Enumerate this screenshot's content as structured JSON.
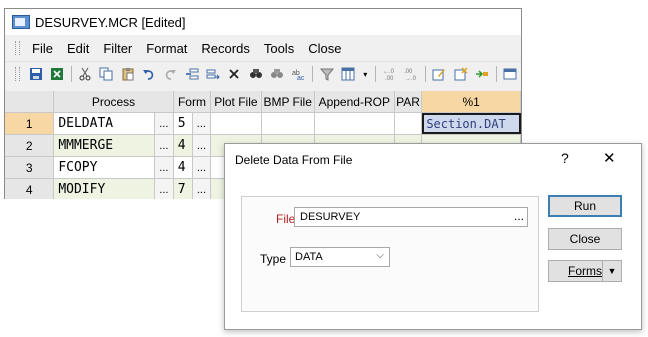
{
  "window": {
    "title": "DESURVEY.MCR [Edited]"
  },
  "menu": [
    "File",
    "Edit",
    "Filter",
    "Format",
    "Records",
    "Tools",
    "Close"
  ],
  "toolbar_icons": [
    "save-icon",
    "excel-export-icon",
    "cut-icon",
    "copy-icon",
    "paste-icon",
    "undo-icon",
    "redo-icon",
    "insert-row-icon",
    "append-row-icon",
    "delete-icon",
    "find-icon",
    "find-next-icon",
    "replace-icon",
    "filter-icon",
    "column-select-icon",
    "decimal-decrease-icon",
    "decimal-increase-icon",
    "edit-form-icon",
    "form-new-icon",
    "macro-run-icon"
  ],
  "grid": {
    "headers": {
      "process": "Process",
      "form": "Form",
      "plot": "Plot File",
      "bmp": "BMP File",
      "append": "Append-ROP",
      "par": "PAR",
      "pct": "%1"
    },
    "ellipsis": "...",
    "rows": [
      {
        "num": "1",
        "process": "DELDATA",
        "form": "5",
        "pct": "Section.DAT"
      },
      {
        "num": "2",
        "process": "MMMERGE",
        "form": "4",
        "pct": ""
      },
      {
        "num": "3",
        "process": "FCOPY",
        "form": "4",
        "pct": ""
      },
      {
        "num": "4",
        "process": "MODIFY",
        "form": "7",
        "pct": ""
      }
    ]
  },
  "dialog": {
    "title": "Delete Data From File",
    "help": "?",
    "close": "✕",
    "file_label": "File",
    "file_value": "DESURVEY",
    "file_browse": "...",
    "type_label": "Type",
    "type_value": "DATA",
    "type_chevron": "⌵",
    "run": "Run",
    "close_button": "Close",
    "forms": "Forms",
    "forms_dropdown": "▼"
  },
  "colors": {
    "accent": "#3c7fb1",
    "header_highlight": "#f7d7a3",
    "alt_row": "#eef3e2",
    "required_label": "#b22222"
  }
}
